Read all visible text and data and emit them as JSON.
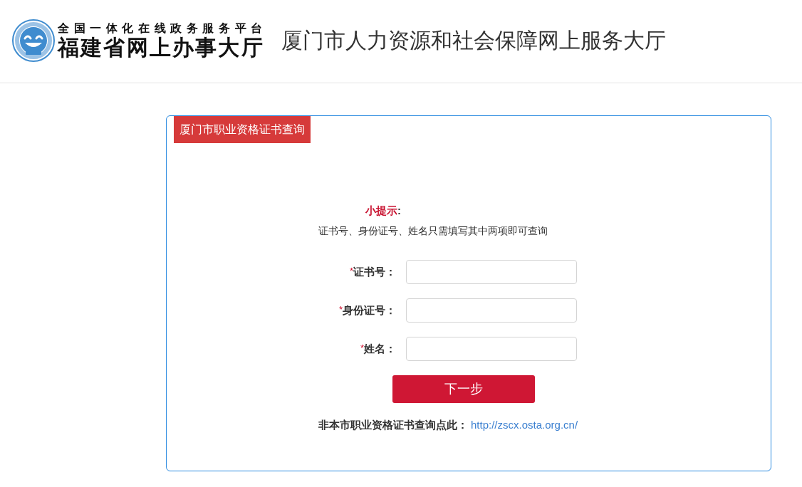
{
  "header": {
    "logo": {
      "tagline": "全国一体化在线政务服务平台",
      "name": "福建省网上办事大厅"
    },
    "title": "厦门市人力资源和社会保障网上服务大厅"
  },
  "query_panel": {
    "title": "厦门市职业资格证书查询",
    "tip": {
      "heading": "小提示",
      "heading_colon": ":",
      "text": "证书号、身份证号、姓名只需填写其中两项即可查询"
    },
    "fields": [
      {
        "mark": "*",
        "label": "证书号："
      },
      {
        "mark": "*",
        "label": "身份证号："
      },
      {
        "mark": "*",
        "label": "姓名："
      }
    ],
    "submit_button": "下一步",
    "footer_note": {
      "text": "非本市职业资格证书查询点此：",
      "link": "http://zscx.osta.org.cn/"
    }
  }
}
